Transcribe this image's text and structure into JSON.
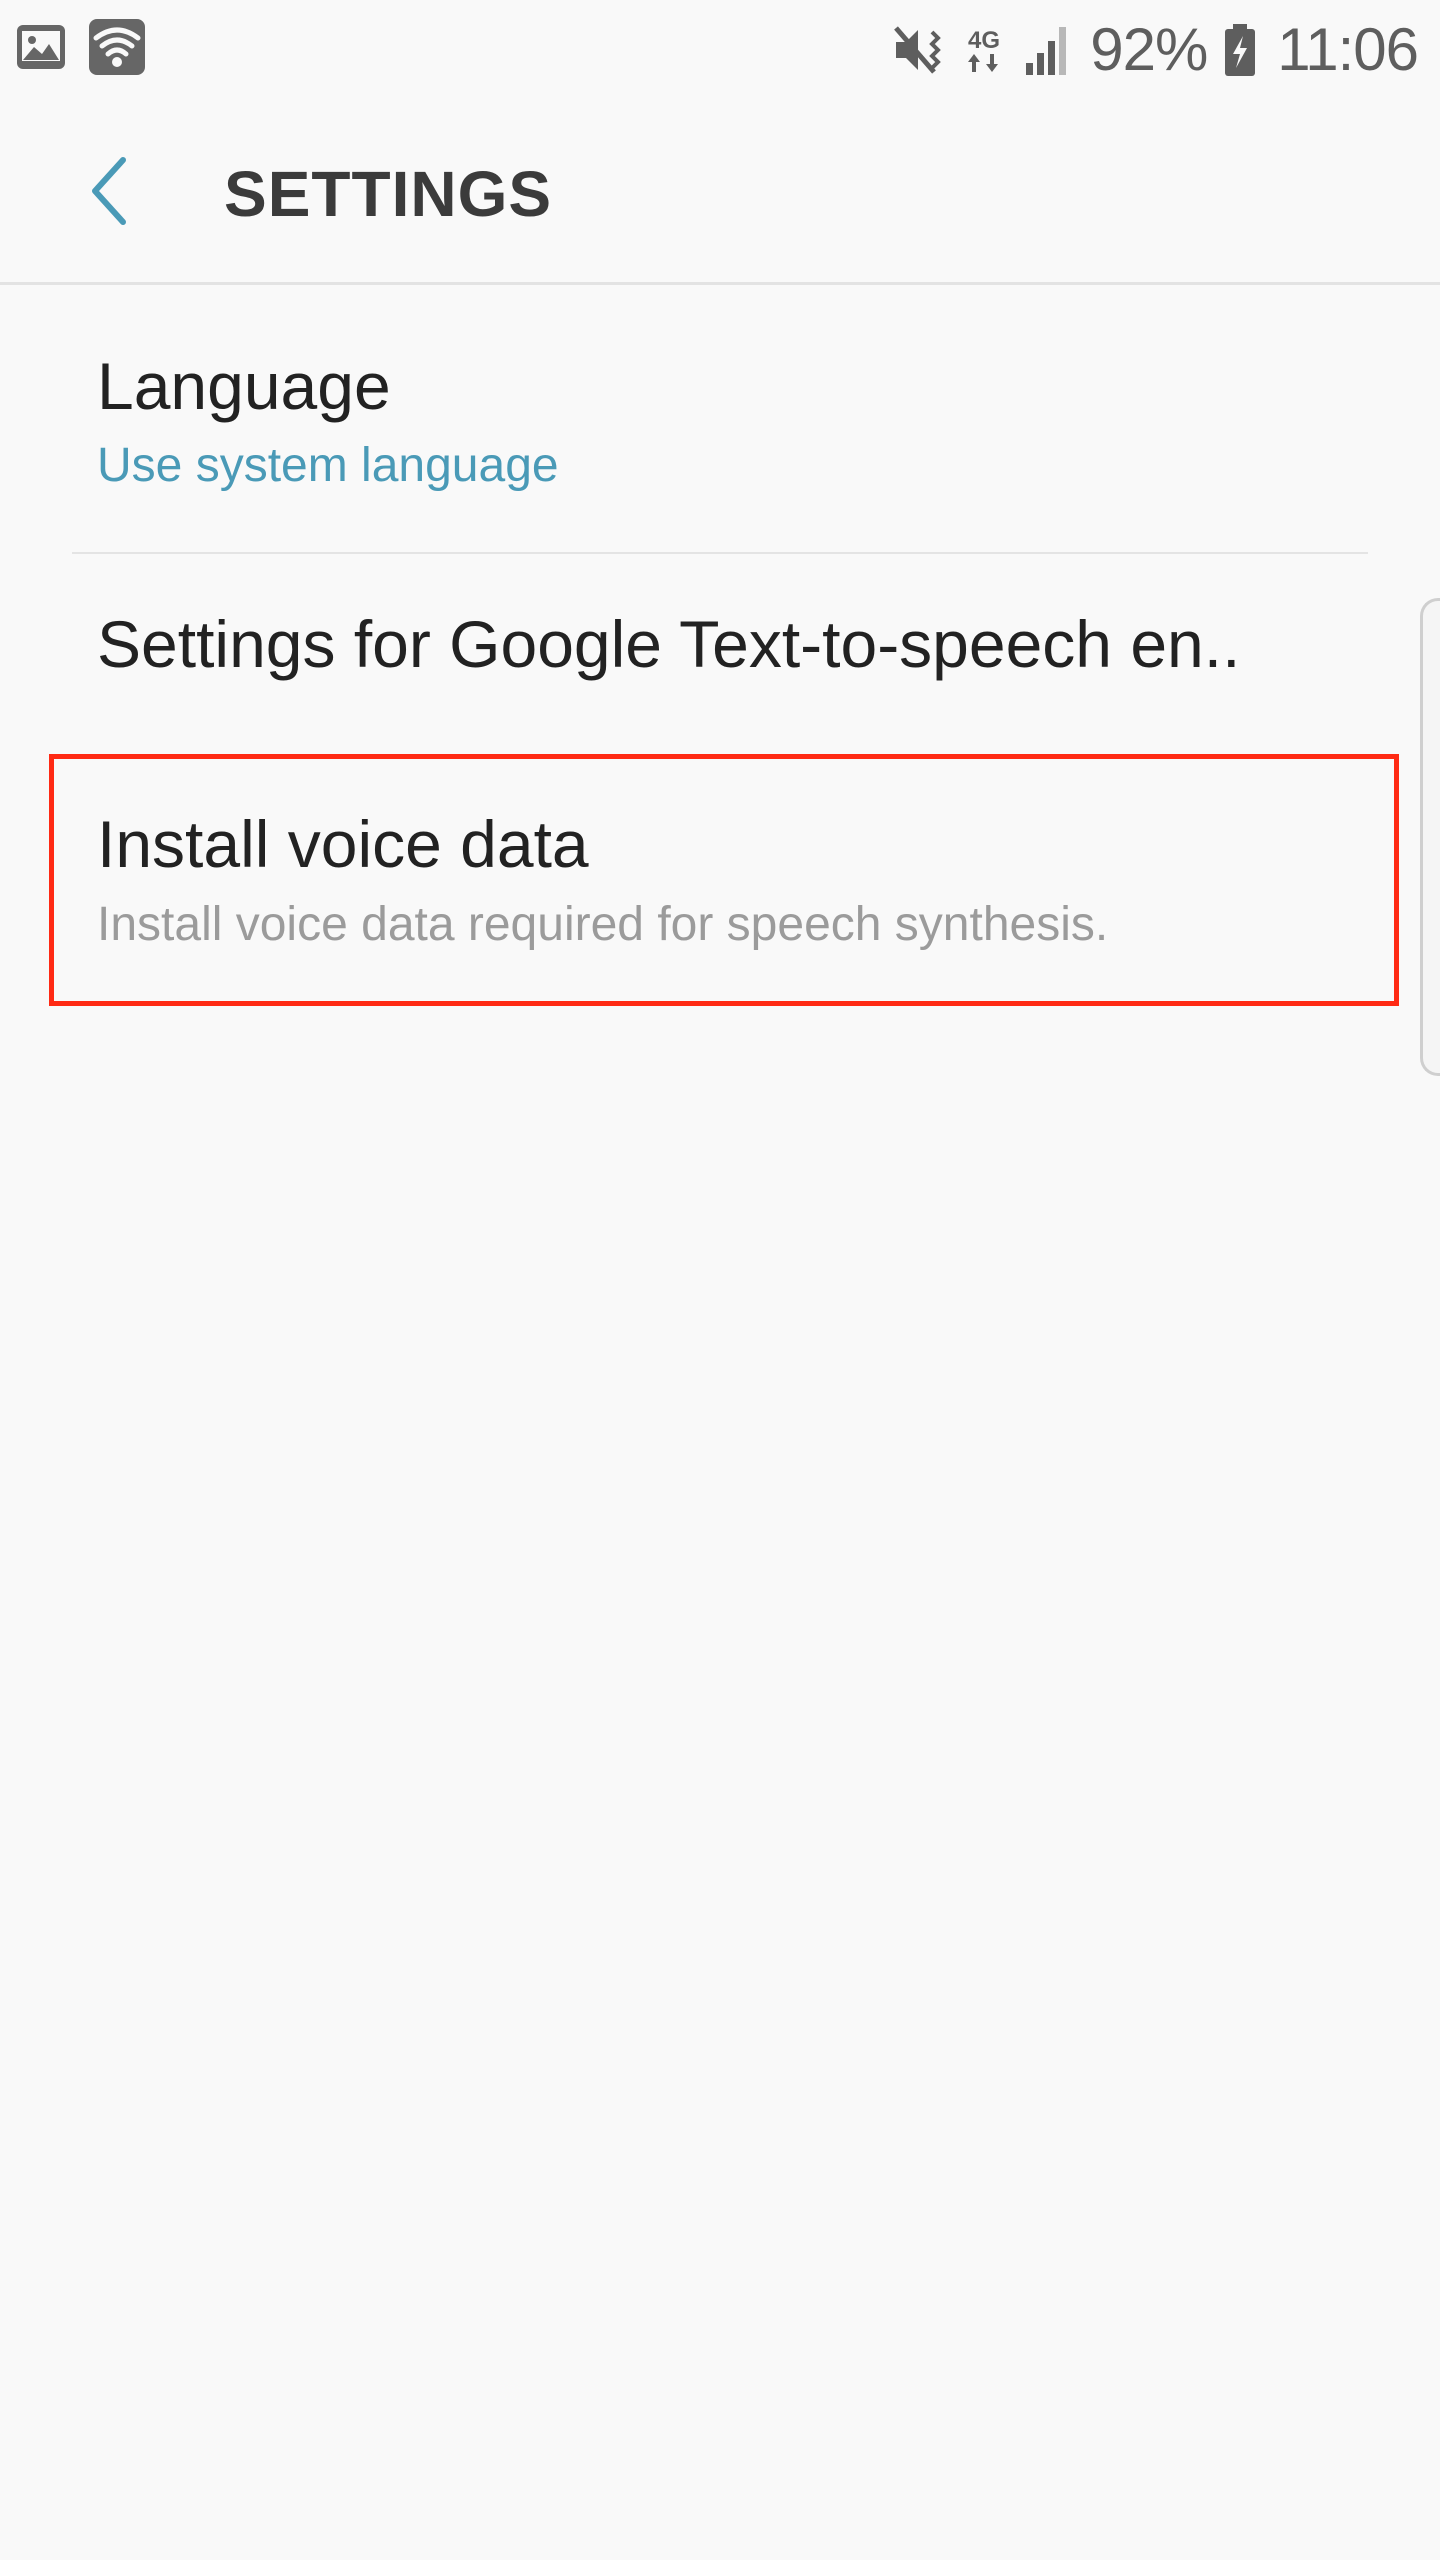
{
  "status_bar": {
    "left_icons": [
      "gallery-notification-icon",
      "wifi-notification-icon"
    ],
    "right_icons": [
      "vibrate-mute-icon",
      "network-4g-icon",
      "signal-strength-icon",
      "battery-charging-icon"
    ],
    "network_label": "4G",
    "battery": "92%",
    "time": "11:06"
  },
  "app_bar": {
    "title": "SETTINGS",
    "accent_color": "#4a9ab7"
  },
  "list": {
    "language": {
      "title": "Language",
      "subtitle": "Use system language"
    },
    "engine_settings": {
      "title": "Settings for Google Text-to-speech en.."
    },
    "install_voice": {
      "title": "Install voice data",
      "subtitle": "Install voice data required for speech synthesis."
    }
  },
  "highlight_color": "#ff2a14"
}
